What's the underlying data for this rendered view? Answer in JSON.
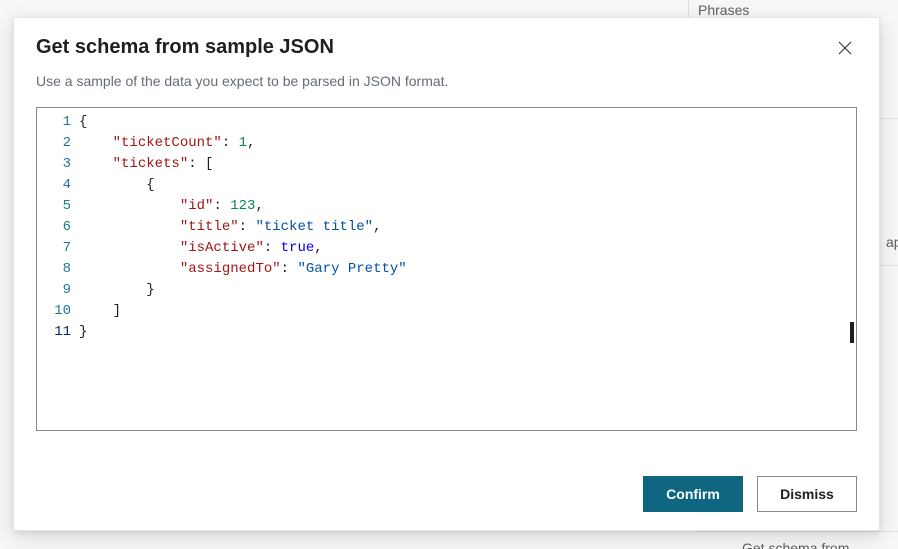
{
  "background": {
    "top_fragment": "Phrases",
    "right_fragment": "ap",
    "bottom_fragment": "Get schema from"
  },
  "dialog": {
    "title": "Get schema from sample JSON",
    "subtitle": "Use a sample of the data you expect to be parsed in JSON format.",
    "confirm_label": "Confirm",
    "dismiss_label": "Dismiss",
    "close_icon_name": "close-icon"
  },
  "editor": {
    "line_numbers": [
      "1",
      "2",
      "3",
      "4",
      "5",
      "6",
      "7",
      "8",
      "9",
      "10",
      "11"
    ],
    "current_line_index": 10,
    "lines": [
      [
        {
          "t": "punc",
          "v": "{"
        }
      ],
      [
        {
          "t": "indent",
          "v": "    "
        },
        {
          "t": "key",
          "v": "\"ticketCount\""
        },
        {
          "t": "punc",
          "v": ": "
        },
        {
          "t": "num",
          "v": "1"
        },
        {
          "t": "punc",
          "v": ","
        }
      ],
      [
        {
          "t": "indent",
          "v": "    "
        },
        {
          "t": "key",
          "v": "\"tickets\""
        },
        {
          "t": "punc",
          "v": ": ["
        }
      ],
      [
        {
          "t": "indent",
          "v": "        "
        },
        {
          "t": "punc",
          "v": "{"
        }
      ],
      [
        {
          "t": "indent",
          "v": "            "
        },
        {
          "t": "key",
          "v": "\"id\""
        },
        {
          "t": "punc",
          "v": ": "
        },
        {
          "t": "num",
          "v": "123"
        },
        {
          "t": "punc",
          "v": ","
        }
      ],
      [
        {
          "t": "indent",
          "v": "            "
        },
        {
          "t": "key",
          "v": "\"title\""
        },
        {
          "t": "punc",
          "v": ": "
        },
        {
          "t": "str",
          "v": "\"ticket title\""
        },
        {
          "t": "punc",
          "v": ","
        }
      ],
      [
        {
          "t": "indent",
          "v": "            "
        },
        {
          "t": "key",
          "v": "\"isActive\""
        },
        {
          "t": "punc",
          "v": ": "
        },
        {
          "t": "bool",
          "v": "true"
        },
        {
          "t": "punc",
          "v": ","
        }
      ],
      [
        {
          "t": "indent",
          "v": "            "
        },
        {
          "t": "key",
          "v": "\"assignedTo\""
        },
        {
          "t": "punc",
          "v": ": "
        },
        {
          "t": "str",
          "v": "\"Gary Pretty\""
        }
      ],
      [
        {
          "t": "indent",
          "v": "        "
        },
        {
          "t": "punc",
          "v": "}"
        }
      ],
      [
        {
          "t": "indent",
          "v": "    "
        },
        {
          "t": "punc",
          "v": "]"
        }
      ],
      [
        {
          "t": "punc",
          "v": "}"
        }
      ]
    ]
  }
}
